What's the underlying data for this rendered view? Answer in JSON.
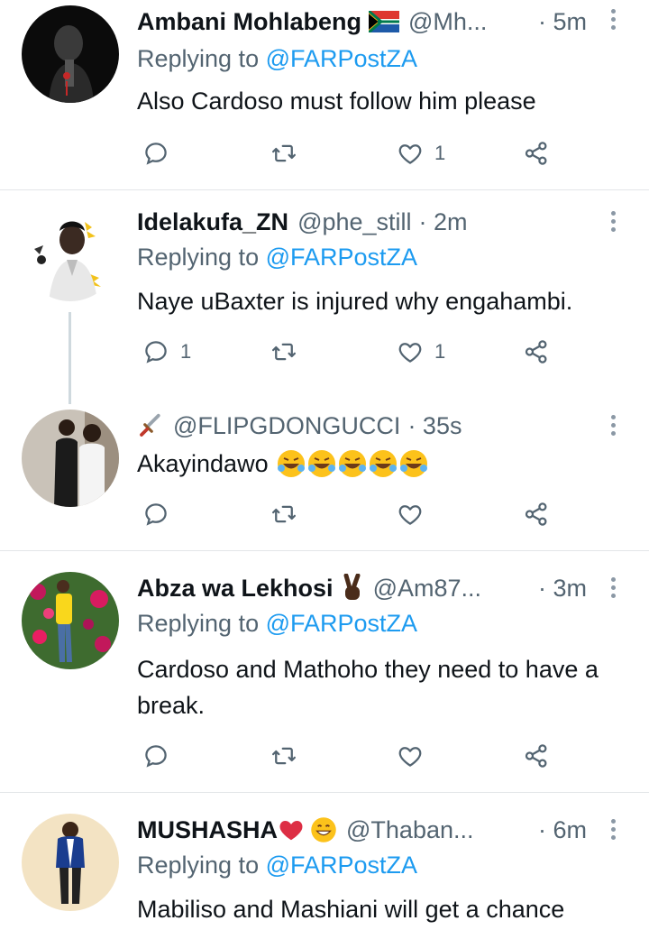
{
  "tweets": [
    {
      "name": "Ambani Mohlabeng",
      "flag_emoji": "🇿🇦",
      "handle": "@Mh...",
      "time": "· 5m",
      "replying_prefix": "Replying to ",
      "replying_mention": "@FARPostZA",
      "text": "Also Cardoso must follow him please",
      "reply_count": "",
      "like_count": "1"
    },
    {
      "name": "Idelakufa_ZN",
      "handle": "@phe_still",
      "time": "· 2m",
      "replying_prefix": "Replying to ",
      "replying_mention": "@FARPostZA",
      "text": "Naye uBaxter is injured why engahambi.",
      "reply_count": "1",
      "like_count": "1"
    },
    {
      "name_emoji": "🗡️",
      "handle": "@FLIPGDONGUCCI",
      "time": "· 35s",
      "text": "Akayindawo",
      "text_emojis": "🤣🤣🤣🤣🤣",
      "reply_count": "",
      "like_count": ""
    },
    {
      "name": "Abza wa Lekhosi",
      "name_emoji": "✌🏿",
      "handle": "@Am87...",
      "time": "· 3m",
      "replying_prefix": "Replying to ",
      "replying_mention": "@FARPostZA",
      "text": "Cardoso and Mathoho they need to have a break.",
      "reply_count": "",
      "like_count": ""
    },
    {
      "name": "MUSHASHA",
      "name_emoji": "❤️😄",
      "handle": "@Thaban...",
      "time": "· 6m",
      "replying_prefix": "Replying to ",
      "replying_mention": "@FARPostZA",
      "text": "Mabiliso and Mashiani will get a chance"
    }
  ],
  "icons": {
    "reply": "reply-icon",
    "retweet": "retweet-icon",
    "like": "heart-icon",
    "share": "share-icon",
    "more": "more-vertical-icon"
  },
  "colors": {
    "accent": "#1d9bf0",
    "muted": "#536471",
    "text": "#0f1419",
    "divider": "#e3e6e8"
  }
}
